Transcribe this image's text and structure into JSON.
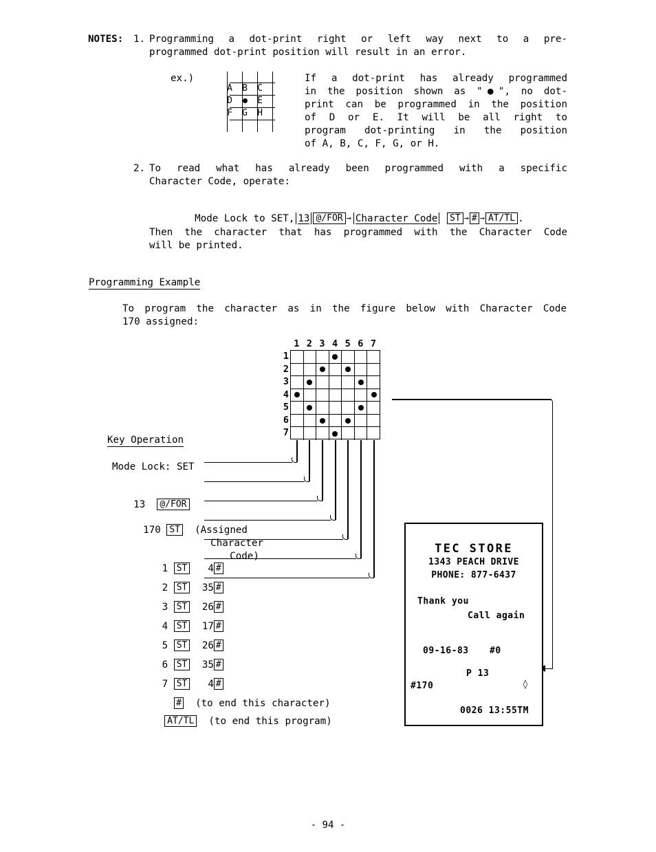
{
  "page": {
    "number_label": "- 94 -"
  },
  "notes": {
    "label": "NOTES:",
    "items": [
      {
        "num": "1.",
        "lines": [
          "Programming a dot-print right or left way next to a pre-",
          "programmed dot-print position will result in an error."
        ]
      },
      {
        "num": "2.",
        "lines": [
          "To read what has already been programmed with a specific",
          "Character Code, operate:"
        ]
      }
    ]
  },
  "example": {
    "label": "ex.)",
    "grid": {
      "rows": [
        [
          "A",
          "B",
          "C"
        ],
        [
          "D",
          "dot",
          "E"
        ],
        [
          "F",
          "G",
          "H"
        ]
      ]
    },
    "description_lines": [
      "If a dot-print has already programmed",
      "in the position shown as \"●\", no dot-",
      "print can be programmed in the position",
      "of D or E.  It will be all right to",
      "program dot-printing in the position",
      "of A, B, C, F, G, or H."
    ]
  },
  "read_sequence": {
    "prefix": "Mode Lock to SET,",
    "code": "13",
    "key_at_for": "@/FOR",
    "char_code_label": "Character Code",
    "key_st": "ST",
    "key_hash": "#",
    "key_at_tl": "AT/TL",
    "period": ".",
    "arrow": "→"
  },
  "then_text": {
    "lines": [
      "Then the character that has programmed with the Character Code",
      "will be printed."
    ]
  },
  "programming_example": {
    "heading": "Programming Example",
    "intro_lines": [
      "To program the character as in the figure below with Character Code",
      "170 assigned:"
    ]
  },
  "matrix": {
    "col_headers": [
      "1",
      "2",
      "3",
      "4",
      "5",
      "6",
      "7"
    ],
    "row_headers": [
      "1",
      "2",
      "3",
      "4",
      "5",
      "6",
      "7"
    ],
    "dots": [
      [
        4
      ],
      [
        3,
        5
      ],
      [
        2,
        6
      ],
      [
        1,
        7
      ],
      [
        2,
        6
      ],
      [
        3,
        5
      ],
      [
        4
      ]
    ]
  },
  "key_operation": {
    "heading": "Key Operation",
    "mode_lock": "Mode Lock: SET",
    "step_code": "13",
    "step_key": "@/FOR",
    "assigned_code": "170",
    "assigned_key": "ST",
    "assigned_note_lines": [
      "(Assigned",
      "Character",
      "Code)"
    ],
    "rows": [
      {
        "row": "1",
        "key_st": "ST",
        "value": "4",
        "key_hash": "#"
      },
      {
        "row": "2",
        "key_st": "ST",
        "value": "35",
        "key_hash": "#"
      },
      {
        "row": "3",
        "key_st": "ST",
        "value": "26",
        "key_hash": "#"
      },
      {
        "row": "4",
        "key_st": "ST",
        "value": "17",
        "key_hash": "#"
      },
      {
        "row": "5",
        "key_st": "ST",
        "value": "26",
        "key_hash": "#"
      },
      {
        "row": "6",
        "key_st": "ST",
        "value": "35",
        "key_hash": "#"
      },
      {
        "row": "7",
        "key_st": "ST",
        "value": "4",
        "key_hash": "#"
      }
    ],
    "end_character": {
      "key": "#",
      "text": "(to end this character)"
    },
    "end_program": {
      "key": "AT/TL",
      "text": "(to end this program)"
    }
  },
  "receipt": {
    "store_name": "TEC STORE",
    "address": "1343 PEACH DRIVE",
    "phone": "PHONE: 877-6437",
    "thank_you": "Thank you",
    "call_again": "Call again",
    "date": "09-16-83",
    "clerk": "#0",
    "program": "P 13",
    "char_code": "#170",
    "printed_char": "◊",
    "footer": "0026 13:55TM"
  }
}
